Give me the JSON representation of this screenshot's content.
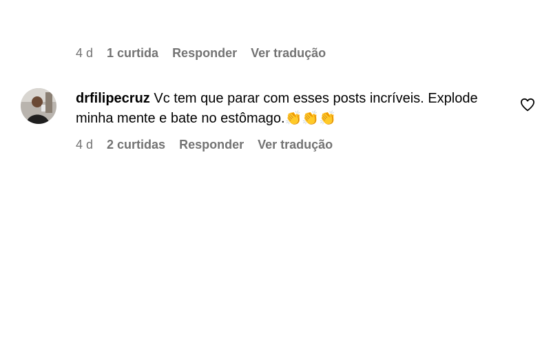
{
  "previous_comment": {
    "time": "4 d",
    "likes": "1 curtida",
    "reply_label": "Responder",
    "translate_label": "Ver tradução"
  },
  "comment": {
    "username": "drfilipecruz",
    "text": "Vc tem que parar com esses posts incríveis. Explode minha mente e bate no estômago.👏👏👏",
    "time": "4 d",
    "likes": "2 curtidas",
    "reply_label": "Responder",
    "translate_label": "Ver tradução",
    "like_icon": "heart-outline-icon"
  },
  "colors": {
    "secondary_text": "#737373",
    "primary_text": "#000000",
    "background": "#ffffff"
  }
}
